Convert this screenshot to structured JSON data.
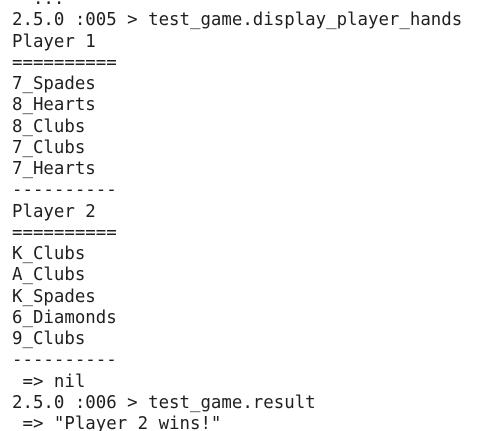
{
  "terminal": {
    "lines": [
      "  ...",
      "2.5.0 :005 > test_game.display_player_hands",
      "Player 1",
      "==========",
      "7_Spades",
      "8_Hearts",
      "8_Clubs",
      "7_Clubs",
      "7_Hearts",
      "----------",
      "Player 2",
      "==========",
      "K_Clubs",
      "A_Clubs",
      "K_Spades",
      "6_Diamonds",
      "9_Clubs",
      "----------",
      " => nil",
      "2.5.0 :006 > test_game.result",
      " => \"Player 2 wins!\""
    ]
  }
}
